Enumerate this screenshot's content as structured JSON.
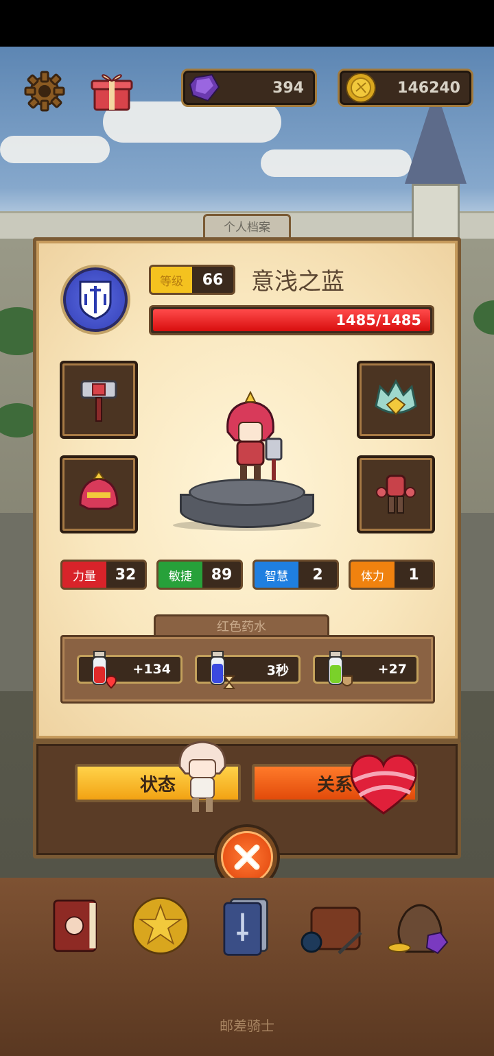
{
  "hud": {
    "gems": "394",
    "gold": "146240"
  },
  "profile_tab": "个人档案",
  "player": {
    "level_label": "等级",
    "level": "66",
    "name": "意浅之蓝",
    "hp_text": "1485/1485",
    "hp_fraction": 1.0
  },
  "equipment": [
    {
      "slot": "weapon",
      "icon": "hammer-icon"
    },
    {
      "slot": "accessory",
      "icon": "crown-gem-icon"
    },
    {
      "slot": "helmet",
      "icon": "helmet-icon"
    },
    {
      "slot": "armor",
      "icon": "armor-icon"
    }
  ],
  "stats": [
    {
      "label": "力量",
      "value": "32",
      "color": "#d8232a"
    },
    {
      "label": "敏捷",
      "value": "89",
      "color": "#27a13a"
    },
    {
      "label": "智慧",
      "value": "2",
      "color": "#1f7fe0"
    },
    {
      "label": "体力",
      "value": "1",
      "color": "#f0820f"
    }
  ],
  "potions": {
    "title": "红色药水",
    "items": [
      {
        "value": "+134",
        "icon": "red-potion-heart-icon"
      },
      {
        "value": "3秒",
        "icon": "blue-potion-hourglass-icon"
      },
      {
        "value": "+27",
        "icon": "green-potion-shield-icon"
      }
    ]
  },
  "actions": {
    "status_label": "状态",
    "relation_label": "关系"
  },
  "dock": {
    "footer": "邮差骑士",
    "items": [
      "journal-book-icon",
      "star-coin-icon",
      "card-deck-icon",
      "bag-potion-icon",
      "loot-sack-icon"
    ]
  }
}
